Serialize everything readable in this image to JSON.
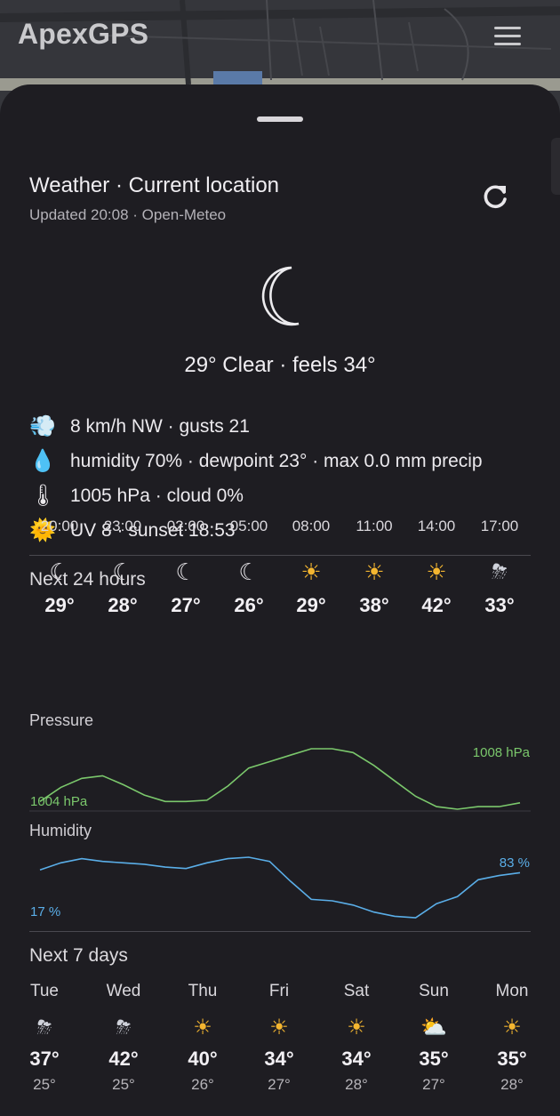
{
  "app": {
    "title": "ApexGPS"
  },
  "weather": {
    "title": "Weather · Current location",
    "updated": "Updated 20:08 · Open-Meteo",
    "summary": "29° Clear · feels 34°",
    "details": [
      {
        "icon": "wind-icon",
        "glyph": "💨",
        "text": "8 km/h NW · gusts 21"
      },
      {
        "icon": "droplet-icon",
        "glyph": "💧",
        "text": "humidity 70% · dewpoint 23° · max 0.0 mm precip"
      },
      {
        "icon": "thermometer-icon",
        "glyph": "🌡",
        "text": "1005 hPa · cloud 0%"
      },
      {
        "icon": "sun-icon",
        "glyph": "🌞",
        "text": "UV 8 · sunset 18:53"
      }
    ]
  },
  "hourly": {
    "title": "Next 24 hours",
    "items": [
      {
        "time": "20:00",
        "icon": "moon-icon",
        "glyph": "☾",
        "temp": "29°"
      },
      {
        "time": "23:00",
        "icon": "moon-icon",
        "glyph": "☾",
        "temp": "28°"
      },
      {
        "time": "02:00",
        "icon": "moon-icon",
        "glyph": "☾",
        "temp": "27°"
      },
      {
        "time": "05:00",
        "icon": "moon-icon",
        "glyph": "☾",
        "temp": "26°"
      },
      {
        "time": "08:00",
        "icon": "sun-icon",
        "glyph": "☀",
        "temp": "29°"
      },
      {
        "time": "11:00",
        "icon": "sun-icon",
        "glyph": "☀",
        "temp": "38°"
      },
      {
        "time": "14:00",
        "icon": "sun-icon",
        "glyph": "☀",
        "temp": "42°"
      },
      {
        "time": "17:00",
        "icon": "storm-icon",
        "glyph": "⛈",
        "temp": "33°"
      }
    ]
  },
  "chart_data": [
    {
      "type": "line",
      "title": "Pressure",
      "series": [
        {
          "values": [
            1004.0,
            1005.1,
            1005.8,
            1006.0,
            1005.3,
            1004.5,
            1004.0,
            1004.0,
            1004.1,
            1005.2,
            1006.6,
            1007.1,
            1007.6,
            1008.1,
            1008.1,
            1007.8,
            1006.8,
            1005.6,
            1004.4,
            1003.6,
            1003.4,
            1003.6,
            1003.6,
            1003.9
          ]
        }
      ],
      "min_label": "1004 hPa",
      "max_label": "1008 hPa",
      "color": "#7bc86c"
    },
    {
      "type": "line",
      "title": "Humidity",
      "series": [
        {
          "values": [
            71,
            76,
            79,
            77,
            76,
            75,
            73,
            72,
            76,
            79,
            80,
            77,
            63,
            50,
            49,
            46,
            41,
            38,
            37,
            47,
            52,
            64,
            67,
            69
          ]
        }
      ],
      "min_label": "17 %",
      "max_label": "83 %",
      "color": "#5aaee8"
    }
  ],
  "daily": {
    "title": "Next 7 days",
    "items": [
      {
        "day": "Tue",
        "icon": "storm-icon",
        "glyph": "⛈",
        "hi": "37°",
        "lo": "25°"
      },
      {
        "day": "Wed",
        "icon": "storm-icon",
        "glyph": "⛈",
        "hi": "42°",
        "lo": "25°"
      },
      {
        "day": "Thu",
        "icon": "sun-icon",
        "glyph": "☀",
        "hi": "40°",
        "lo": "26°"
      },
      {
        "day": "Fri",
        "icon": "sun-icon",
        "glyph": "☀",
        "hi": "34°",
        "lo": "27°"
      },
      {
        "day": "Sat",
        "icon": "sun-icon",
        "glyph": "☀",
        "hi": "34°",
        "lo": "28°"
      },
      {
        "day": "Sun",
        "icon": "partly-cloudy-icon",
        "glyph": "⛅",
        "hi": "35°",
        "lo": "27°"
      },
      {
        "day": "Mon",
        "icon": "sun-icon",
        "glyph": "☀",
        "hi": "35°",
        "lo": "28°"
      }
    ]
  }
}
